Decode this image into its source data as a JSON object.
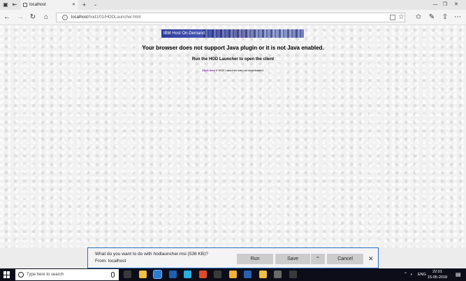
{
  "browser": {
    "tab_title": "localhost",
    "address_host": "localhost",
    "address_path": "/hod1/01/HODLauncher.html"
  },
  "page": {
    "banner_text": "IBM Host On-Demand",
    "main_message": "Your browser does not support Java plugin or it is not Java enabled.",
    "sub_message": "Run the HOD Launcher to open the client",
    "link_text": "Click here",
    "link_suffix": " if HOD Launcher was not downloaded."
  },
  "download": {
    "question": "What do you want to do with hodlauncher.msi (536 KB)?",
    "from": "From: localhost",
    "run_label": "Run",
    "save_label": "Save",
    "cancel_label": "Cancel"
  },
  "taskbar": {
    "search_placeholder": "Type here to search",
    "language": "ENG",
    "time": "22:01",
    "date": "15-05-2018",
    "app_colors": [
      "#3a3a3a",
      "#f0c040",
      "#2b7cd3",
      "#1e5fb0",
      "#2bb0e0",
      "#e04a2a",
      "#3a3a3a",
      "#f2b233",
      "#2b5fb0",
      "#f0c040",
      "#6a6a6a",
      "#3a3a3a"
    ]
  },
  "colors": {
    "accent": "#2b6cc4",
    "link": "#7a1fa0"
  }
}
